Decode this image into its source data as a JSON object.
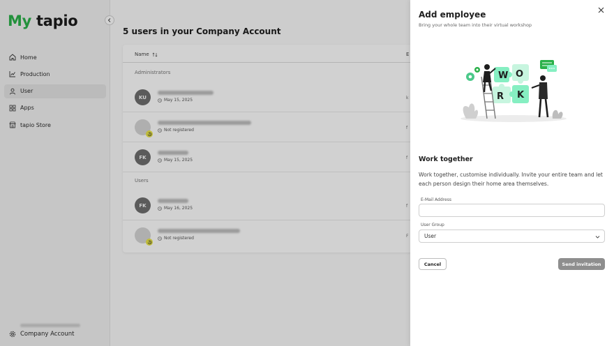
{
  "logo": {
    "part1": "My",
    "part2": "tapio"
  },
  "sidebar": {
    "items": [
      {
        "label": "Home",
        "icon": "home-icon"
      },
      {
        "label": "Production",
        "icon": "chart-icon"
      },
      {
        "label": "User",
        "icon": "user-icon",
        "active": true
      },
      {
        "label": "Apps",
        "icon": "apps-icon"
      },
      {
        "label": "tapio Store",
        "icon": "store-icon"
      }
    ],
    "account_label": "Company Account"
  },
  "main": {
    "title": "5 users in your Company Account",
    "columns": {
      "name": "Name",
      "email": "E"
    },
    "sections": {
      "admins": "Administrators",
      "users": "Users"
    },
    "rows": [
      {
        "initials": "KU",
        "meta": "May 15, 2025",
        "email": "k",
        "pending": false
      },
      {
        "initials": "",
        "meta": "Not registered",
        "email": "f",
        "pending": true
      },
      {
        "initials": "FK",
        "meta": "May 15, 2025",
        "email": "f",
        "pending": false
      },
      {
        "initials": "FK",
        "meta": "May 16, 2025",
        "email": "f",
        "pending": false
      },
      {
        "initials": "",
        "meta": "Not registered",
        "email": "F",
        "pending": true
      }
    ]
  },
  "drawer": {
    "title": "Add employee",
    "subtitle": "Bring your whole team into their virtual workshop",
    "heading": "Work together",
    "paragraph": "Work together, customise individually. Invite your entire team and let each person design their home area themselves.",
    "email_label": "E-Mail Address",
    "email_value": "",
    "group_label": "User Group",
    "group_value": "User",
    "cancel_label": "Cancel",
    "send_label": "Send invitation",
    "illustration_letters": [
      "W",
      "O",
      "R",
      "K"
    ]
  },
  "colors": {
    "brand_green": "#2bb14a",
    "puzzle_green": "#86efc2",
    "pending_yellow": "#e9e447",
    "disabled_button": "#8e8e8e"
  }
}
